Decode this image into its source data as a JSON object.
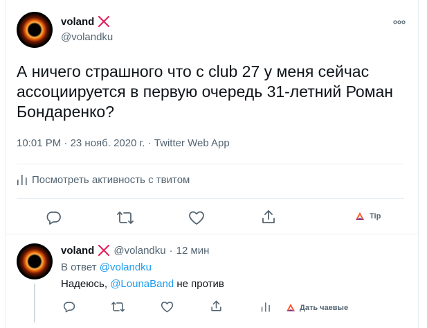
{
  "tweet": {
    "author_name": "voland",
    "author_handle": "@volandku",
    "text": "А ничего страшного что с club 27 у меня сейчас ассоциируется в первую очередь 31-летний Роман Бондаренко?",
    "time": "10:01 PM",
    "date": "23 нояб. 2020 г.",
    "source": "Twitter Web App",
    "activity_label": "Посмотреть активность с твитом",
    "tip_label": "Tip"
  },
  "reply": {
    "author_name": "voland",
    "author_handle": "@volandku",
    "time_ago": "12 мин",
    "reply_prefix": "В ответ",
    "reply_to_handle": "@volandku",
    "text_before": "Надеюсь,",
    "mention": "@LounaBand",
    "text_after": "не против",
    "tips_label": "Дать чаевые"
  },
  "colors": {
    "accent": "#1d9bf0",
    "secondary_text": "#536471",
    "brave_red": "#e0245e"
  },
  "icons": [
    "cross-mark-icon",
    "more-icon",
    "reply-icon",
    "retweet-icon",
    "like-icon",
    "share-icon",
    "activity-icon",
    "brave-tip-icon"
  ]
}
